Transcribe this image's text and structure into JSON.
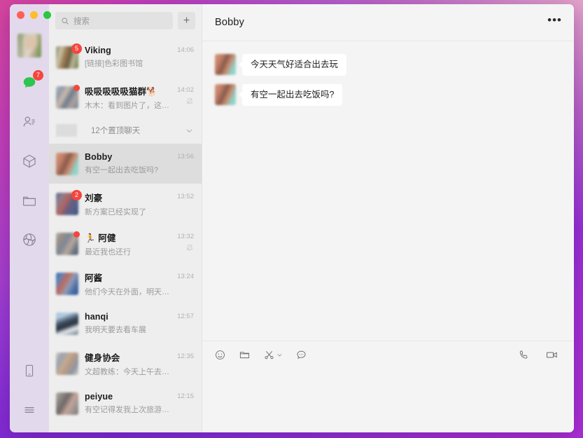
{
  "window": {
    "traffic_lights": [
      "close",
      "minimize",
      "zoom"
    ],
    "colors": {
      "badge": "#f5453d",
      "green": "#2dc44f",
      "selected_row": "#dddddd"
    }
  },
  "rail": {
    "items": [
      {
        "name": "profile-avatar",
        "icon": "avatar",
        "badge": null
      },
      {
        "name": "chats",
        "icon": "chat-bubble-icon",
        "badge": "7",
        "active": true
      },
      {
        "name": "contacts",
        "icon": "contacts-icon",
        "badge": null
      },
      {
        "name": "favorites",
        "icon": "box-icon",
        "badge": null
      },
      {
        "name": "files",
        "icon": "folder-icon",
        "badge": null
      },
      {
        "name": "moments",
        "icon": "aperture-icon",
        "badge": null
      }
    ],
    "bottom_items": [
      {
        "name": "phone-sync",
        "icon": "phone-icon"
      },
      {
        "name": "menu",
        "icon": "hamburger-icon"
      }
    ]
  },
  "search": {
    "placeholder": "搜索",
    "icon": "search-icon",
    "add_label": "+"
  },
  "pinned": {
    "label": "12个置顶聊天",
    "chevron": "chevron-down-icon"
  },
  "chats": [
    {
      "name": "Viking",
      "preview": "[链接]色彩图书馆",
      "time": "14:06",
      "badge": "5",
      "dot": false,
      "muted": false,
      "selected": false,
      "av": "a1"
    },
    {
      "name": "吸吸吸吸吸猫群🐕",
      "preview": "木木：看到图片了，这张图拍…",
      "time": "14:02",
      "badge": null,
      "dot": true,
      "muted": true,
      "selected": false,
      "av": "a2"
    },
    {
      "name": "Bobby",
      "preview": "有空一起出去吃饭吗?",
      "time": "13:56",
      "badge": null,
      "dot": false,
      "muted": false,
      "selected": true,
      "av": "a3"
    },
    {
      "name": "刘豪",
      "preview": "新方案已经实现了",
      "time": "13:52",
      "badge": "2",
      "dot": false,
      "muted": false,
      "selected": false,
      "av": "a4"
    },
    {
      "name": "🏃 阿健",
      "preview": "最近我也还行",
      "time": "13:32",
      "badge": null,
      "dot": true,
      "muted": true,
      "selected": false,
      "av": "a5"
    },
    {
      "name": "阿酱",
      "preview": "他们今天在外面，明天我讲…",
      "time": "13:24",
      "badge": null,
      "dot": false,
      "muted": false,
      "selected": false,
      "av": "a6"
    },
    {
      "name": "hanqi",
      "preview": "我明天要去看车展",
      "time": "12:57",
      "badge": null,
      "dot": false,
      "muted": false,
      "selected": false,
      "av": "a7"
    },
    {
      "name": "健身协会",
      "preview": "文超教练：今天上午去跑了步",
      "time": "12:35",
      "badge": null,
      "dot": false,
      "muted": false,
      "selected": false,
      "av": "a8"
    },
    {
      "name": "peiyue",
      "preview": "有空记得发我上次旅游的照片",
      "time": "12:15",
      "badge": null,
      "dot": false,
      "muted": false,
      "selected": false,
      "av": "a9"
    }
  ],
  "conversation": {
    "title": "Bobby",
    "more_label": "•••",
    "messages": [
      {
        "sender": "Bobby",
        "text": "今天天气好适合出去玩",
        "side": "left",
        "av": "a3"
      },
      {
        "sender": "Bobby",
        "text": "有空一起出去吃饭吗?",
        "side": "left",
        "av": "a3"
      }
    ]
  },
  "composer": {
    "tools": [
      {
        "name": "emoji-button",
        "icon": "smiley-icon"
      },
      {
        "name": "file-button",
        "icon": "folder-icon"
      },
      {
        "name": "screenshot-button",
        "icon": "scissors-icon",
        "has_dropdown": true
      },
      {
        "name": "chat-history-button",
        "icon": "speech-bubble-icon"
      }
    ],
    "right_tools": [
      {
        "name": "voice-call-button",
        "icon": "phone-icon"
      },
      {
        "name": "video-call-button",
        "icon": "video-camera-icon"
      }
    ],
    "input_placeholder": ""
  }
}
